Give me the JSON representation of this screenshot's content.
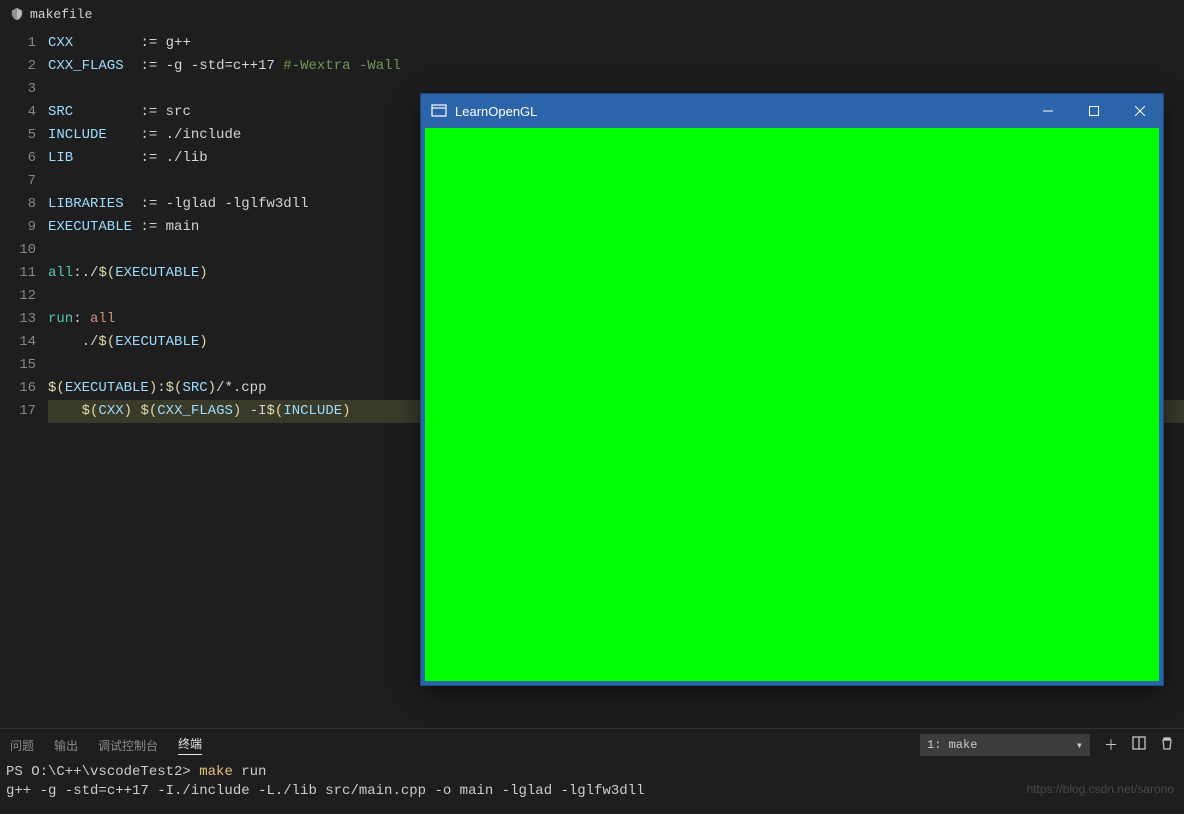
{
  "tab": {
    "filename": "makefile"
  },
  "code": {
    "lines": [
      {
        "n": 1,
        "segs": [
          [
            "var",
            "CXX"
          ],
          [
            "ws",
            "        "
          ],
          [
            "op",
            ":="
          ],
          [
            "ws",
            " "
          ],
          [
            "txt",
            "g++"
          ]
        ]
      },
      {
        "n": 2,
        "segs": [
          [
            "var",
            "CXX_FLAGS"
          ],
          [
            "ws",
            "  "
          ],
          [
            "op",
            ":="
          ],
          [
            "ws",
            " "
          ],
          [
            "txt",
            "-g -std=c++17 "
          ],
          [
            "cmt",
            "#-Wextra -Wall"
          ]
        ]
      },
      {
        "n": 3,
        "segs": []
      },
      {
        "n": 4,
        "segs": [
          [
            "var",
            "SRC"
          ],
          [
            "ws",
            "        "
          ],
          [
            "op",
            ":="
          ],
          [
            "ws",
            " "
          ],
          [
            "txt",
            "src"
          ]
        ]
      },
      {
        "n": 5,
        "segs": [
          [
            "var",
            "INCLUDE"
          ],
          [
            "ws",
            "    "
          ],
          [
            "op",
            ":="
          ],
          [
            "ws",
            " "
          ],
          [
            "txt",
            "./include"
          ]
        ]
      },
      {
        "n": 6,
        "segs": [
          [
            "var",
            "LIB"
          ],
          [
            "ws",
            "        "
          ],
          [
            "op",
            ":="
          ],
          [
            "ws",
            " "
          ],
          [
            "txt",
            "./lib"
          ]
        ]
      },
      {
        "n": 7,
        "segs": []
      },
      {
        "n": 8,
        "segs": [
          [
            "var",
            "LIBRARIES"
          ],
          [
            "ws",
            "  "
          ],
          [
            "op",
            ":="
          ],
          [
            "ws",
            " "
          ],
          [
            "txt",
            "-lglad -lglfw3dll"
          ]
        ]
      },
      {
        "n": 9,
        "segs": [
          [
            "var",
            "EXECUTABLE"
          ],
          [
            "ws",
            " "
          ],
          [
            "op",
            ":="
          ],
          [
            "ws",
            " "
          ],
          [
            "txt",
            "main"
          ]
        ]
      },
      {
        "n": 10,
        "segs": []
      },
      {
        "n": 11,
        "segs": [
          [
            "tgt",
            "all"
          ],
          [
            "op",
            ":"
          ],
          [
            "txt",
            "./"
          ],
          [
            "dollar",
            "$("
          ],
          [
            "arg",
            "EXECUTABLE"
          ],
          [
            "dollar",
            ")"
          ]
        ]
      },
      {
        "n": 12,
        "segs": []
      },
      {
        "n": 13,
        "segs": [
          [
            "tgt",
            "run"
          ],
          [
            "op",
            ":"
          ],
          [
            "ws",
            " "
          ],
          [
            "prq",
            "all"
          ]
        ]
      },
      {
        "n": 14,
        "segs": [
          [
            "ws",
            "    "
          ],
          [
            "txt",
            "./"
          ],
          [
            "dollar",
            "$("
          ],
          [
            "arg",
            "EXECUTABLE"
          ],
          [
            "dollar",
            ")"
          ]
        ]
      },
      {
        "n": 15,
        "segs": []
      },
      {
        "n": 16,
        "segs": [
          [
            "dollar",
            "$("
          ],
          [
            "arg",
            "EXECUTABLE"
          ],
          [
            "dollar",
            ")"
          ],
          [
            "op",
            ":"
          ],
          [
            "dollar",
            "$("
          ],
          [
            "arg",
            "SRC"
          ],
          [
            "dollar",
            ")"
          ],
          [
            "txt",
            "/*.cpp"
          ]
        ]
      },
      {
        "n": 17,
        "hl": true,
        "segs": [
          [
            "ws",
            "    "
          ],
          [
            "dollar",
            "$("
          ],
          [
            "arg",
            "CXX"
          ],
          [
            "dollar",
            ")"
          ],
          [
            "ws",
            " "
          ],
          [
            "dollar",
            "$("
          ],
          [
            "arg",
            "CXX_FLAGS"
          ],
          [
            "dollar",
            ")"
          ],
          [
            "ws",
            " "
          ],
          [
            "txt",
            "-I"
          ],
          [
            "dollar",
            "$("
          ],
          [
            "arg",
            "INCLUDE"
          ],
          [
            "dollar",
            ")"
          ]
        ]
      }
    ]
  },
  "panel": {
    "tabs": {
      "problems": "问题",
      "output": "输出",
      "debug": "调试控制台",
      "terminal": "终端"
    },
    "active_tab": "terminal",
    "terminal_select": "1: make",
    "lines": [
      {
        "prompt": "PS O:\\C++\\vscodeTest2> ",
        "cmd": "make",
        "arg": " run"
      },
      {
        "out": "g++ -g -std=c++17  -I./include -L./lib src/main.cpp -o main  -lglad -lglfw3dll"
      }
    ]
  },
  "opengl": {
    "title": "LearnOpenGL",
    "bg_color": "#00ff00",
    "titlebar_color": "#2b64a9"
  },
  "watermark": "https://blog.csdn.net/sarono"
}
